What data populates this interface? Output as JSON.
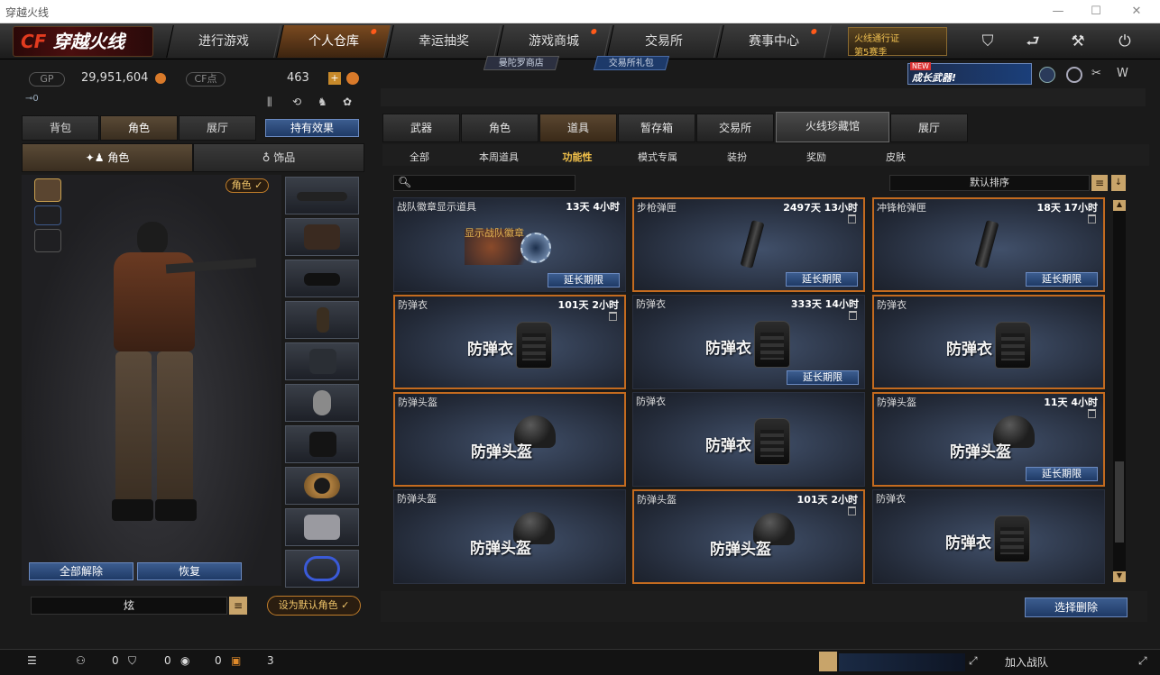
{
  "window": {
    "title": "穿越火线",
    "minimize": "—",
    "maximize": "☐",
    "close": "✕"
  },
  "logo": {
    "cf": "CF",
    "text": "穿越火线"
  },
  "nav": {
    "tabs": [
      "进行游戏",
      "个人仓库",
      "幸运抽奖",
      "游戏商城",
      "交易所",
      "赛事中心"
    ],
    "active": 1
  },
  "sub_nav": {
    "shop": "曼陀罗商店",
    "gift": "交易所礼包"
  },
  "season_badge": {
    "line1": "火线通行证",
    "line2": "第5赛季"
  },
  "promo": {
    "new": "NEW",
    "text": "成长武器!"
  },
  "currency": {
    "gp_label": "GP",
    "gp_value": "29,951,604",
    "cf_label": "CF点",
    "cf_value": "463",
    "plus": "+"
  },
  "inventory": {
    "tabs": [
      "背包",
      "角色",
      "展厅"
    ],
    "active_tab": 1,
    "effects_button": "持有效果",
    "sub_tabs": [
      "角色",
      "饰品"
    ],
    "role_tag": "角色",
    "unequip_all": "全部解除",
    "restore": "恢复",
    "name_value": "炫",
    "set_default": "设为默认角色"
  },
  "categories": {
    "tabs": [
      "武器",
      "角色",
      "道具",
      "暂存箱",
      "交易所",
      "火线珍藏馆",
      "展厅"
    ],
    "active": 2
  },
  "filters": {
    "items": [
      "全部",
      "本周道具",
      "功能性",
      "模式专属",
      "装扮",
      "奖励",
      "皮肤"
    ],
    "active": 2
  },
  "sort": {
    "label": "默认排序"
  },
  "extend_label": "延长期限",
  "items": [
    {
      "name": "战队徽章显示道具",
      "time": "13天 4小时",
      "overlay": "显示战队徽章",
      "kind": "badge",
      "extend": true,
      "highlight": false,
      "bin": false
    },
    {
      "name": "步枪弹匣",
      "time": "2497天 13小时",
      "overlay": "",
      "kind": "mag",
      "extend": true,
      "highlight": true,
      "bin": true
    },
    {
      "name": "冲锋枪弹匣",
      "time": "18天 17小时",
      "overlay": "",
      "kind": "mag",
      "extend": true,
      "highlight": true,
      "bin": true
    },
    {
      "name": "防弹衣",
      "time": "101天 2小时",
      "overlay": "防弹衣",
      "kind": "vest",
      "extend": false,
      "highlight": true,
      "bin": true
    },
    {
      "name": "防弹衣",
      "time": "333天 14小时",
      "overlay": "防弹衣",
      "kind": "vest",
      "extend": true,
      "highlight": false,
      "bin": true
    },
    {
      "name": "防弹衣",
      "time": "",
      "overlay": "防弹衣",
      "kind": "vest",
      "extend": false,
      "highlight": true,
      "bin": false
    },
    {
      "name": "防弹头盔",
      "time": "",
      "overlay": "防弹头盔",
      "kind": "helm",
      "extend": false,
      "highlight": true,
      "bin": false
    },
    {
      "name": "防弹衣",
      "time": "",
      "overlay": "防弹衣",
      "kind": "vest",
      "extend": false,
      "highlight": false,
      "bin": false
    },
    {
      "name": "防弹头盔",
      "time": "11天 4小时",
      "overlay": "防弹头盔",
      "kind": "helm",
      "extend": true,
      "highlight": true,
      "bin": true
    },
    {
      "name": "防弹头盔",
      "time": "",
      "overlay": "防弹头盔",
      "kind": "helm",
      "extend": false,
      "highlight": false,
      "bin": false
    },
    {
      "name": "防弹头盔",
      "time": "101天 2小时",
      "overlay": "防弹头盔",
      "kind": "helm",
      "extend": false,
      "highlight": true,
      "bin": true
    },
    {
      "name": "防弹衣",
      "time": "",
      "overlay": "防弹衣",
      "kind": "vest",
      "extend": false,
      "highlight": false,
      "bin": false
    }
  ],
  "select_delete": "选择删除",
  "bottom": {
    "c1": "0",
    "c2": "0",
    "c3": "0",
    "c4": "3",
    "join": "加入战队"
  },
  "colors": {
    "accent": "#c46b1f",
    "blue": "#3c5d8f",
    "gold": "#f2c14a"
  }
}
